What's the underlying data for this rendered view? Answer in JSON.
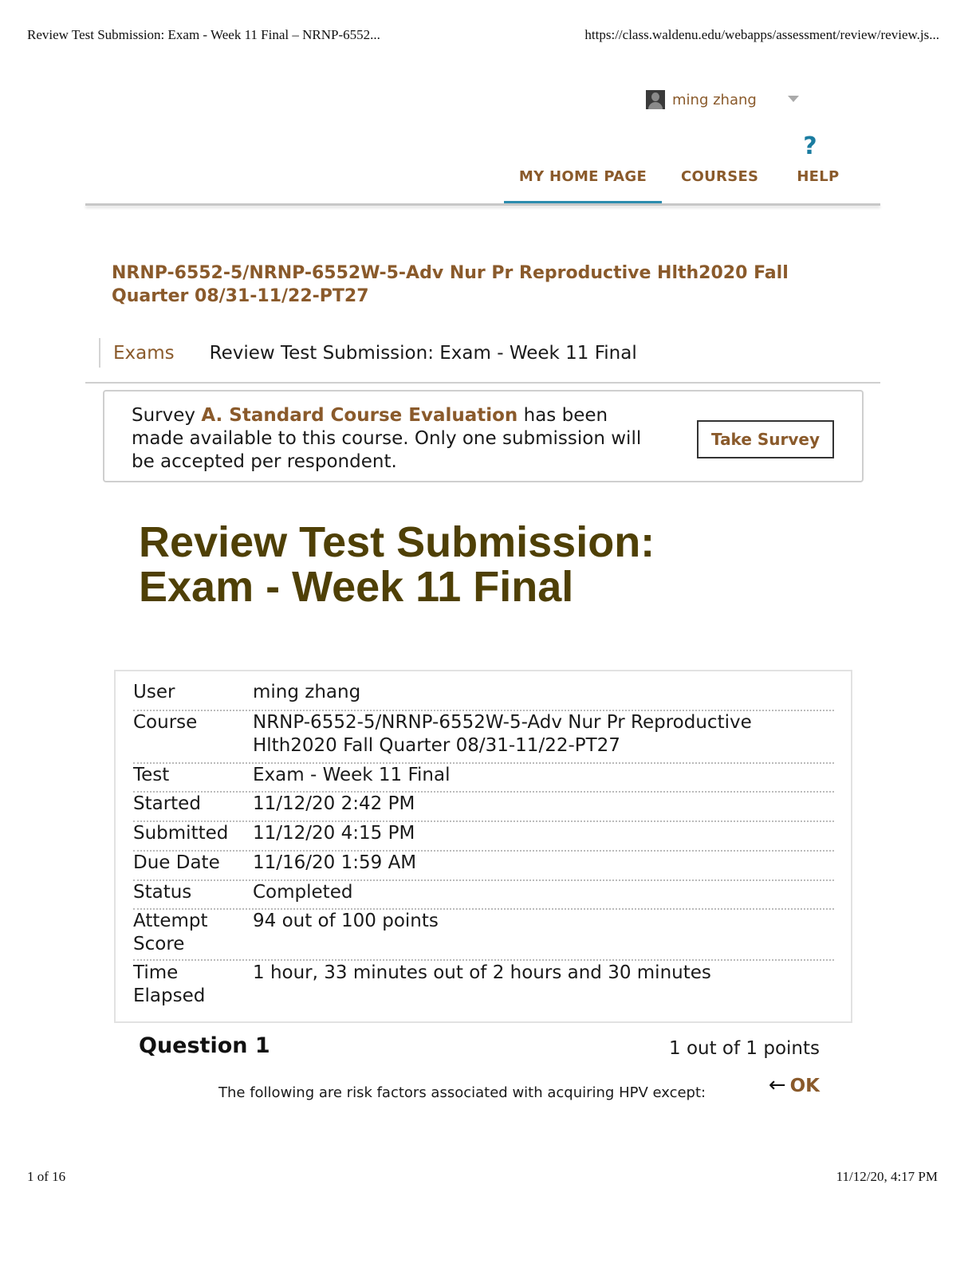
{
  "print_header": {
    "title": "Review Test Submission: Exam - Week 11 Final – NRNP-6552...",
    "url": "https://class.waldenu.edu/webapps/assessment/review/review.js..."
  },
  "print_footer": {
    "page": "1 of 16",
    "datetime": "11/12/20, 4:17 PM"
  },
  "user_menu": {
    "name": "ming zhang",
    "avatar_icon": "user-avatar",
    "caret_icon": "chevron-down-icon"
  },
  "nav": {
    "help_icon": "?",
    "items": [
      {
        "label": "MY HOME PAGE",
        "active": true
      },
      {
        "label": "COURSES",
        "active": false
      },
      {
        "label": "HELP",
        "active": false
      }
    ]
  },
  "course": {
    "title": "NRNP-6552-5/NRNP-6552W-5-Adv Nur Pr Reproductive Hlth2020 Fall Quarter 08/31-11/22-PT27"
  },
  "breadcrumb": {
    "parent": "Exams",
    "current": "Review Test Submission: Exam - Week 11 Final"
  },
  "survey": {
    "prefix": "Survey ",
    "link": "A. Standard Course Evaluation",
    "suffix": " has been made available to this course. Only one submission will be accepted per respondent.",
    "button": "Take Survey"
  },
  "page_title": "Review Test Submission: Exam - Week 11 Final",
  "details": [
    {
      "label": "User",
      "value": "ming zhang"
    },
    {
      "label": "Course",
      "value": "NRNP-6552-5/NRNP-6552W-5-Adv Nur Pr Reproductive Hlth2020 Fall Quarter 08/31-11/22-PT27"
    },
    {
      "label": "Test",
      "value": "Exam - Week 11 Final"
    },
    {
      "label": "Started",
      "value": "11/12/20 2:42 PM"
    },
    {
      "label": "Submitted",
      "value": "11/12/20 4:15 PM"
    },
    {
      "label": "Due Date",
      "value": "11/16/20 1:59 AM"
    },
    {
      "label": "Status",
      "value": "Completed"
    },
    {
      "label": "Attempt Score",
      "value": "94 out of 100 points"
    },
    {
      "label": "Time Elapsed",
      "value": "1 hour, 33 minutes out of 2 hours and 30 minutes"
    }
  ],
  "question": {
    "title": "Question 1",
    "points": "1 out of 1 points",
    "text": "The following are risk factors associated with acquiring HPV except:",
    "arrow": "←",
    "result": "OK"
  },
  "colors": {
    "brand_brown": "#8a5a2b",
    "title_olive": "#4f4006",
    "nav_accent": "#2b8cad",
    "help_blue": "#1a7ca0"
  }
}
